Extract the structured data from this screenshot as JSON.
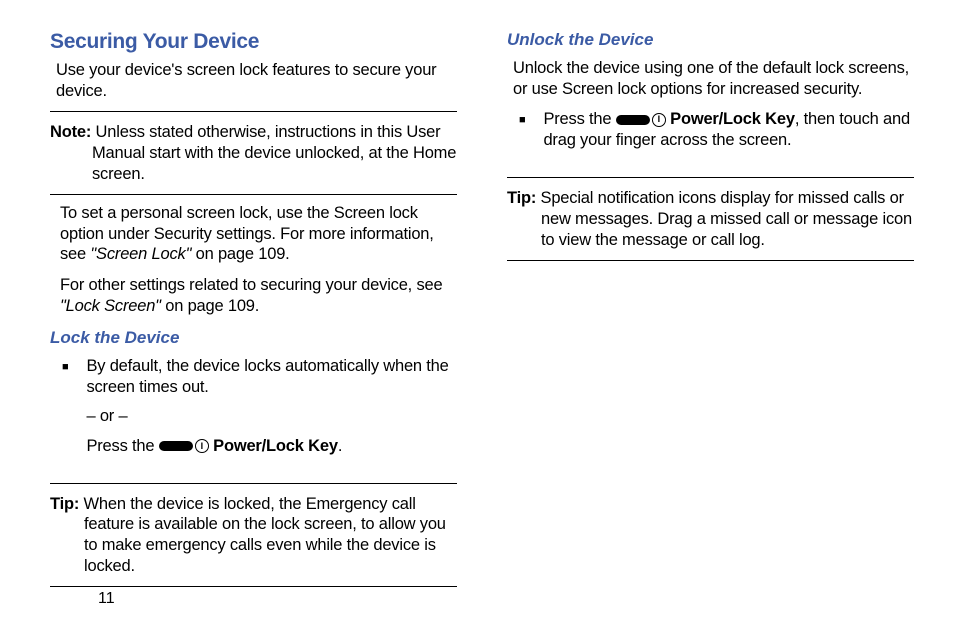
{
  "pageNumber": "11",
  "left": {
    "headingMain": "Securing Your Device",
    "intro": "Use your device's screen lock features to secure your device.",
    "noteLabel": "Note:",
    "noteBody": " Unless stated otherwise, instructions in this User Manual start with the device unlocked, at the Home screen.",
    "para1a": "To set a personal screen lock, use the Screen lock option under Security settings. For more information, see ",
    "para1ref": "\"Screen Lock\"",
    "para1b": " on page 109.",
    "para2a": "For other settings related to securing your device, see ",
    "para2ref": "\"Lock Screen\"",
    "para2b": " on page 109.",
    "subHeading": "Lock the Device",
    "bullet1": "By default, the device locks automatically when the screen times out.",
    "orSep": "– or –",
    "pressPrefix": "Press the ",
    "circChar": "I",
    "keyLabel": "Power/Lock Key",
    "keySuffix": ".",
    "tipLabel": "Tip:",
    "tipBody": " When the device is locked, the Emergency call feature is available on the lock screen, to allow you to make emergency calls even while the device is locked."
  },
  "right": {
    "subHeading": "Unlock the Device",
    "intro": "Unlock the device using one of the default lock screens, or use Screen lock options for increased security.",
    "bulletPrefix": "Press the ",
    "circChar": "I",
    "keyLabel": "Power/Lock Key",
    "bulletSuffix": ", then touch and drag your finger across the screen.",
    "tipLabel": "Tip:",
    "tipBody": " Special notification icons display for missed calls or new messages. Drag a missed call or message icon to view the message or call log."
  }
}
